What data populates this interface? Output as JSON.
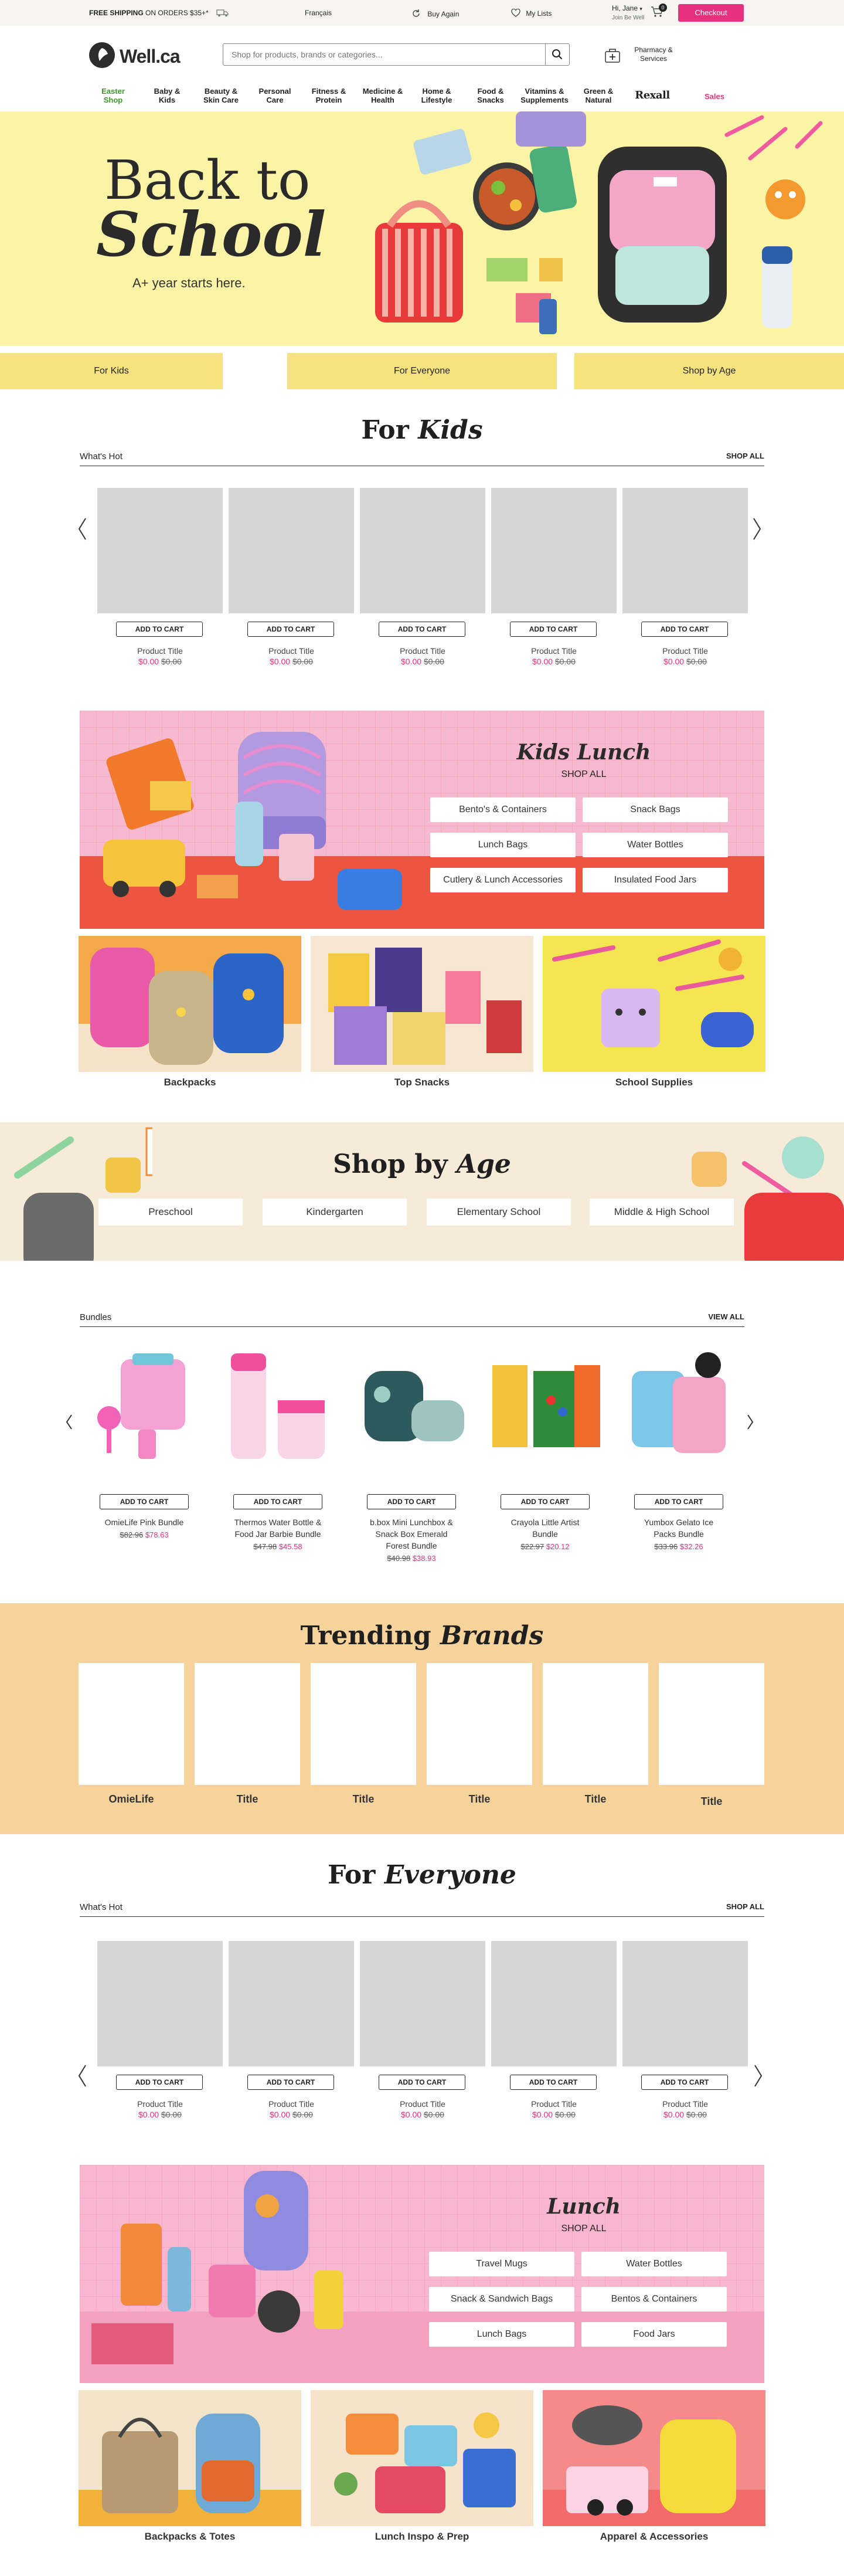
{
  "util": {
    "shipping_bold": "FREE SHIPPING",
    "shipping_rest": "ON ORDERS $35+*",
    "language": "Français",
    "buy_again": "Buy Again",
    "my_lists": "My Lists",
    "greeting": "Hi, Jane",
    "greeting_sub": "Join Be Well",
    "cart_count": "0",
    "checkout": "Checkout"
  },
  "header": {
    "logo": "Well.ca",
    "search_placeholder": "Shop for products, brands or categories...",
    "pharmacy": "Pharmacy & Services"
  },
  "nav": [
    {
      "l1": "Easter",
      "l2": "Shop"
    },
    {
      "l1": "Baby &",
      "l2": "Kids"
    },
    {
      "l1": "Beauty &",
      "l2": "Skin Care"
    },
    {
      "l1": "Personal",
      "l2": "Care"
    },
    {
      "l1": "Fitness &",
      "l2": "Protein"
    },
    {
      "l1": "Medicine &",
      "l2": "Health"
    },
    {
      "l1": "Home &",
      "l2": "Lifestyle"
    },
    {
      "l1": "Food &",
      "l2": "Snacks"
    },
    {
      "l1": "Vitamins &",
      "l2": "Supplements"
    },
    {
      "l1": "Green &",
      "l2": "Natural"
    },
    {
      "l1": "Rexall",
      "l2": ""
    },
    {
      "l1": "Sales",
      "l2": ""
    }
  ],
  "hero": {
    "line1": "Back to",
    "line2": "School",
    "sub": "A+ year starts here."
  },
  "tabs": [
    "For Kids",
    "For Everyone",
    "Shop by Age"
  ],
  "for_kids": {
    "title_a": "For ",
    "title_b": "Kids",
    "row_label": "What's Hot",
    "shop_all": "SHOP ALL",
    "products": [
      {
        "cta": "ADD TO CART",
        "title": "Product Title",
        "price": "$0.00",
        "was": "$0.00"
      },
      {
        "cta": "ADD TO CART",
        "title": "Product Title",
        "price": "$0.00",
        "was": "$0.00"
      },
      {
        "cta": "ADD TO CART",
        "title": "Product Title",
        "price": "$0.00",
        "was": "$0.00"
      },
      {
        "cta": "ADD TO CART",
        "title": "Product Title",
        "price": "$0.00",
        "was": "$0.00"
      },
      {
        "cta": "ADD TO CART",
        "title": "Product Title",
        "price": "$0.00",
        "was": "$0.00"
      }
    ]
  },
  "kids_lunch": {
    "title": "Kids Lunch",
    "shop_all": "SHOP ALL",
    "buttons": [
      "Bento's & Containers",
      "Snack Bags",
      "Lunch Bags",
      "Water Bottles",
      "Cutlery & Lunch Accessories",
      "Insulated Food Jars"
    ]
  },
  "kids_tiles": [
    "Backpacks",
    "Top Snacks",
    "School Supplies"
  ],
  "shop_by_age": {
    "title_a": "Shop by ",
    "title_b": "Age",
    "buttons": [
      "Preschool",
      "Kindergarten",
      "Elementary School",
      "Middle & High School"
    ]
  },
  "bundles": {
    "label": "Bundles",
    "view_all": "VIEW ALL",
    "items": [
      {
        "cta": "ADD TO CART",
        "name1": "OmieLife Pink Bundle",
        "name2": "",
        "name3": "",
        "was": "$82.96",
        "price": "$78.63"
      },
      {
        "cta": "ADD TO CART",
        "name1": "Thermos Water Bottle &",
        "name2": "Food Jar Barbie Bundle",
        "name3": "",
        "was": "$47.98",
        "price": "$45.58"
      },
      {
        "cta": "ADD TO CART",
        "name1": "b.box Mini Lunchbox &",
        "name2": "Snack Box Emerald",
        "name3": "Forest Bundle",
        "was": "$40.98",
        "price": "$38.93"
      },
      {
        "cta": "ADD TO CART",
        "name1": "Crayola Little Artist",
        "name2": "Bundle",
        "name3": "",
        "was": "$22.97",
        "price": "$20.12"
      },
      {
        "cta": "ADD TO CART",
        "name1": "Yumbox Gelato Ice",
        "name2": "Packs Bundle",
        "name3": "",
        "was": "$33.96",
        "price": "$32.26"
      }
    ]
  },
  "trending": {
    "title_a": "Trending ",
    "title_b": "Brands",
    "brands": [
      "OmieLife",
      "Title",
      "Title",
      "Title",
      "Title",
      "Title"
    ]
  },
  "for_everyone": {
    "title_a": "For ",
    "title_b": "Everyone",
    "row_label": "What's Hot",
    "shop_all": "SHOP ALL",
    "products": [
      {
        "cta": "ADD TO CART",
        "title": "Product Title",
        "price": "$0.00",
        "was": "$0.00"
      },
      {
        "cta": "ADD TO CART",
        "title": "Product Title",
        "price": "$0.00",
        "was": "$0.00"
      },
      {
        "cta": "ADD TO CART",
        "title": "Product Title",
        "price": "$0.00",
        "was": "$0.00"
      },
      {
        "cta": "ADD TO CART",
        "title": "Product Title",
        "price": "$0.00",
        "was": "$0.00"
      },
      {
        "cta": "ADD TO CART",
        "title": "Product Title",
        "price": "$0.00",
        "was": "$0.00"
      }
    ]
  },
  "lunch": {
    "title": "Lunch",
    "shop_all": "SHOP ALL",
    "buttons": [
      "Travel Mugs",
      "Water Bottles",
      "Snack & Sandwich Bags",
      "Bentos & Containers",
      "Lunch Bags",
      "Food Jars"
    ]
  },
  "everyone_tiles": [
    "Backpacks & Totes",
    "Lunch Inspo & Prep",
    "Apparel & Accessories"
  ],
  "icons": [
    "truck-icon",
    "refresh-icon",
    "heart-icon",
    "cart-icon",
    "search-icon",
    "pharmacy-icon",
    "chevron-left-icon",
    "chevron-right-icon"
  ],
  "colors": {
    "accent": "#e8317e",
    "hero_bg": "#fbf3a6",
    "tab_bg": "#f6e27f",
    "kids_lunch_bg": "#f7b9cf",
    "age_bg": "#f6ead9",
    "trending_bg": "#f7d39c",
    "nav_green": "#3a9a2a"
  }
}
